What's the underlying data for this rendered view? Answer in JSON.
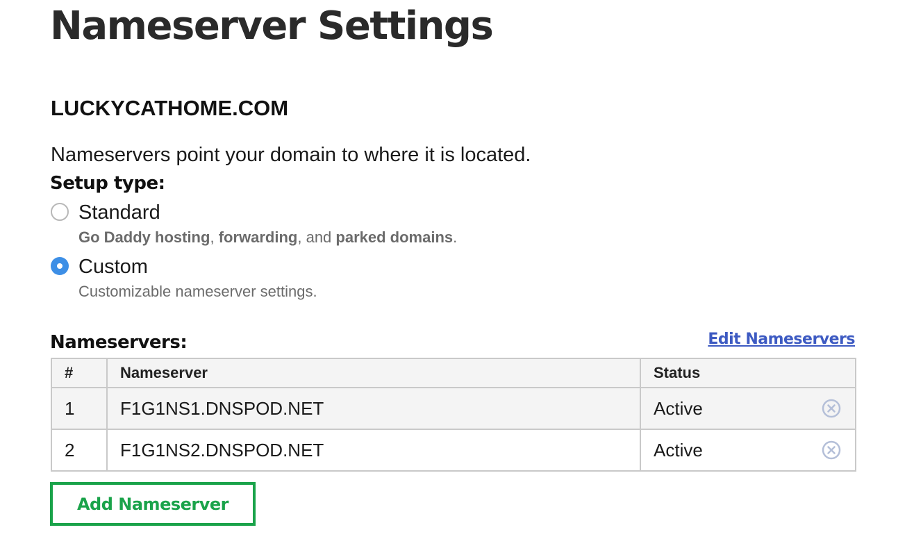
{
  "page": {
    "title": "Nameserver Settings",
    "domain": "LUCKYCATHOME.COM",
    "description": "Nameservers point your domain to where it is located."
  },
  "setup": {
    "label": "Setup type:",
    "options": [
      {
        "label": "Standard",
        "selected": false,
        "desc": {
          "part1": "Go Daddy hosting",
          "sep1": ", ",
          "part2": "forwarding",
          "sep2": ", and ",
          "part3": "parked domains",
          "end": "."
        }
      },
      {
        "label": "Custom",
        "selected": true,
        "desc_text": "Customizable nameserver settings."
      }
    ]
  },
  "nameservers": {
    "heading": "Nameservers:",
    "edit_link": "Edit Nameservers",
    "columns": [
      "#",
      "Nameserver",
      "Status"
    ],
    "rows": [
      {
        "num": "1",
        "name": "F1G1NS1.DNSPOD.NET",
        "status": "Active",
        "remove_icon": "remove-circle-icon"
      },
      {
        "num": "2",
        "name": "F1G1NS2.DNSPOD.NET",
        "status": "Active",
        "remove_icon": "remove-circle-icon"
      }
    ],
    "add_button": "Add Nameserver"
  },
  "colors": {
    "accent_green": "#1aa34a",
    "link_blue": "#3d5ac2",
    "radio_blue": "#3d8fe6",
    "remove_icon": "#b4bfd8"
  }
}
